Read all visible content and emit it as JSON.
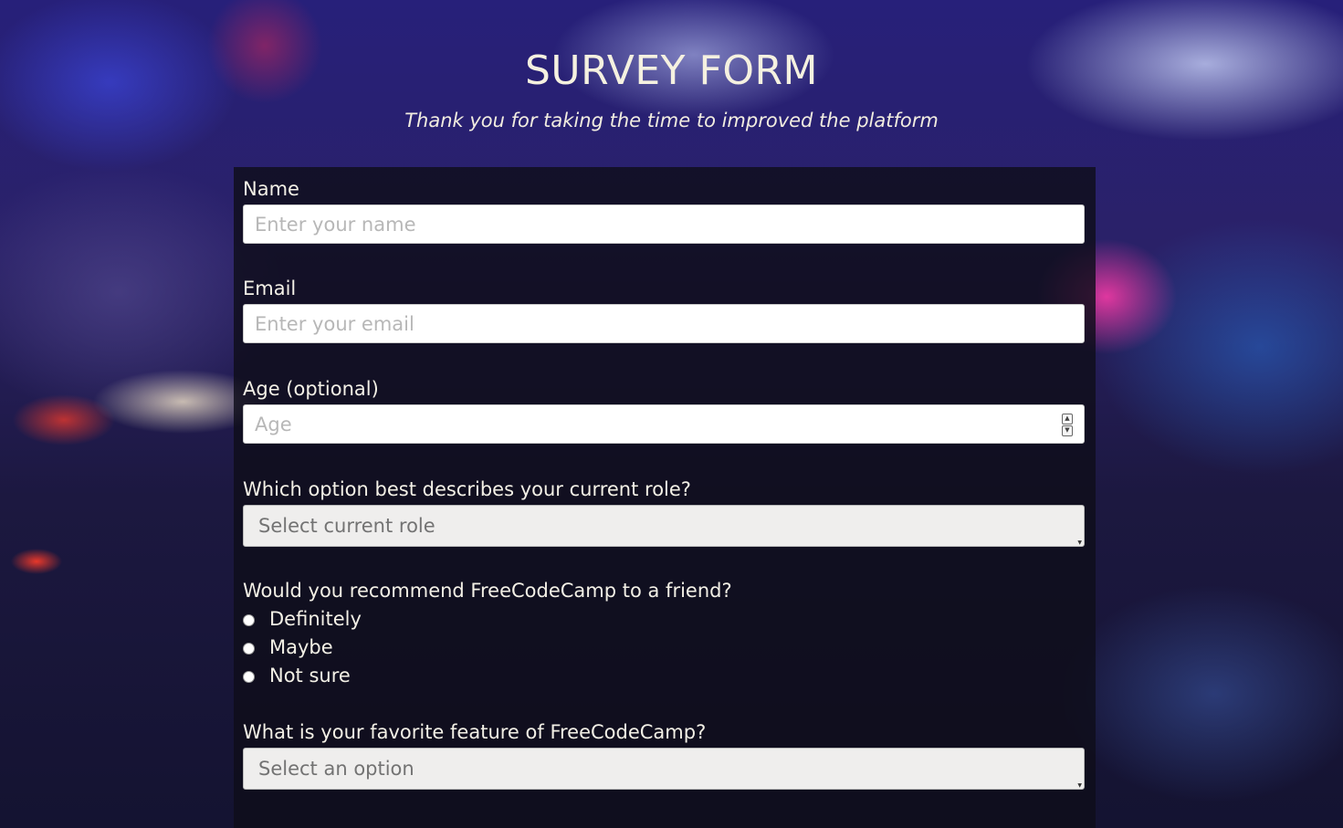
{
  "header": {
    "title": "SURVEY FORM",
    "subtitle": "Thank you for taking the time to improved the platform"
  },
  "form": {
    "name": {
      "label": "Name",
      "placeholder": "Enter your name",
      "value": ""
    },
    "email": {
      "label": "Email",
      "placeholder": "Enter your email",
      "value": ""
    },
    "age": {
      "label": "Age (optional)",
      "placeholder": "Age",
      "value": ""
    },
    "role": {
      "label": "Which option best describes your current role?",
      "selected": "Select current role"
    },
    "recommend": {
      "label": "Would you recommend FreeCodeCamp to a friend?",
      "options": [
        {
          "label": "Definitely",
          "checked": false
        },
        {
          "label": "Maybe",
          "checked": false
        },
        {
          "label": "Not sure",
          "checked": false
        }
      ]
    },
    "favorite_feature": {
      "label": "What is your favorite feature of FreeCodeCamp?",
      "selected": "Select an option"
    }
  },
  "colors": {
    "panel": "#0f0d1a",
    "text": "#f3f0e6",
    "title": "#f5f1e0"
  }
}
